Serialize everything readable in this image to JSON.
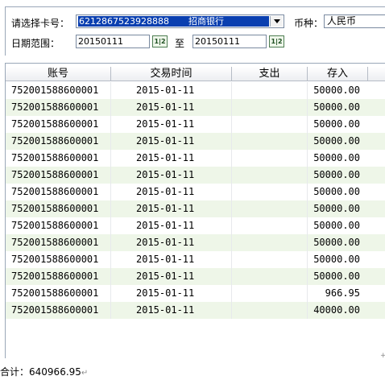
{
  "filters": {
    "card_label": "请选择卡号：",
    "card_number": "6212867523928888",
    "card_bank": "招商银行",
    "currency_label": "币种：",
    "currency_value": "人民币",
    "date_label": "日期范围：",
    "date_from": "20150111",
    "date_to": "20150111",
    "to_label": "至",
    "calendar_icon_text": "1|2"
  },
  "table": {
    "columns": [
      "账号",
      "交易时间",
      "支出",
      "存入"
    ],
    "rows": [
      {
        "account": "752001588600001",
        "time": "2015-01-11",
        "out": "",
        "in": "50000.00"
      },
      {
        "account": "752001588600001",
        "time": "2015-01-11",
        "out": "",
        "in": "50000.00"
      },
      {
        "account": "752001588600001",
        "time": "2015-01-11",
        "out": "",
        "in": "50000.00"
      },
      {
        "account": "752001588600001",
        "time": "2015-01-11",
        "out": "",
        "in": "50000.00"
      },
      {
        "account": "752001588600001",
        "time": "2015-01-11",
        "out": "",
        "in": "50000.00"
      },
      {
        "account": "752001588600001",
        "time": "2015-01-11",
        "out": "",
        "in": "50000.00"
      },
      {
        "account": "752001588600001",
        "time": "2015-01-11",
        "out": "",
        "in": "50000.00"
      },
      {
        "account": "752001588600001",
        "time": "2015-01-11",
        "out": "",
        "in": "50000.00"
      },
      {
        "account": "752001588600001",
        "time": "2015-01-11",
        "out": "",
        "in": "50000.00"
      },
      {
        "account": "752001588600001",
        "time": "2015-01-11",
        "out": "",
        "in": "50000.00"
      },
      {
        "account": "752001588600001",
        "time": "2015-01-11",
        "out": "",
        "in": "50000.00"
      },
      {
        "account": "752001588600001",
        "time": "2015-01-11",
        "out": "",
        "in": "50000.00"
      },
      {
        "account": "752001588600001",
        "time": "2015-01-11",
        "out": "",
        "in": "966.95"
      },
      {
        "account": "752001588600001",
        "time": "2015-01-11",
        "out": "",
        "in": "40000.00"
      }
    ]
  },
  "summary": {
    "total_label": "合计：",
    "total_value": "640966.95"
  },
  "colors": {
    "selection": "#0a3fb0",
    "alt_row": "#eef6e8"
  }
}
